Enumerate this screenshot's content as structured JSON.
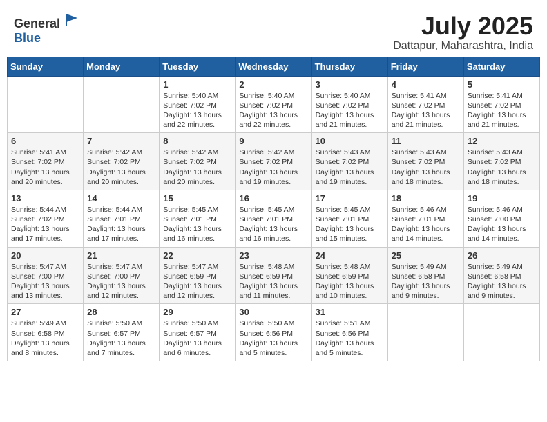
{
  "logo": {
    "general": "General",
    "blue": "Blue"
  },
  "title": "July 2025",
  "location": "Dattapur, Maharashtra, India",
  "days_of_week": [
    "Sunday",
    "Monday",
    "Tuesday",
    "Wednesday",
    "Thursday",
    "Friday",
    "Saturday"
  ],
  "weeks": [
    [
      {
        "day": "",
        "sunrise": "",
        "sunset": "",
        "daylight": ""
      },
      {
        "day": "",
        "sunrise": "",
        "sunset": "",
        "daylight": ""
      },
      {
        "day": "1",
        "sunrise": "Sunrise: 5:40 AM",
        "sunset": "Sunset: 7:02 PM",
        "daylight": "Daylight: 13 hours and 22 minutes."
      },
      {
        "day": "2",
        "sunrise": "Sunrise: 5:40 AM",
        "sunset": "Sunset: 7:02 PM",
        "daylight": "Daylight: 13 hours and 22 minutes."
      },
      {
        "day": "3",
        "sunrise": "Sunrise: 5:40 AM",
        "sunset": "Sunset: 7:02 PM",
        "daylight": "Daylight: 13 hours and 21 minutes."
      },
      {
        "day": "4",
        "sunrise": "Sunrise: 5:41 AM",
        "sunset": "Sunset: 7:02 PM",
        "daylight": "Daylight: 13 hours and 21 minutes."
      },
      {
        "day": "5",
        "sunrise": "Sunrise: 5:41 AM",
        "sunset": "Sunset: 7:02 PM",
        "daylight": "Daylight: 13 hours and 21 minutes."
      }
    ],
    [
      {
        "day": "6",
        "sunrise": "Sunrise: 5:41 AM",
        "sunset": "Sunset: 7:02 PM",
        "daylight": "Daylight: 13 hours and 20 minutes."
      },
      {
        "day": "7",
        "sunrise": "Sunrise: 5:42 AM",
        "sunset": "Sunset: 7:02 PM",
        "daylight": "Daylight: 13 hours and 20 minutes."
      },
      {
        "day": "8",
        "sunrise": "Sunrise: 5:42 AM",
        "sunset": "Sunset: 7:02 PM",
        "daylight": "Daylight: 13 hours and 20 minutes."
      },
      {
        "day": "9",
        "sunrise": "Sunrise: 5:42 AM",
        "sunset": "Sunset: 7:02 PM",
        "daylight": "Daylight: 13 hours and 19 minutes."
      },
      {
        "day": "10",
        "sunrise": "Sunrise: 5:43 AM",
        "sunset": "Sunset: 7:02 PM",
        "daylight": "Daylight: 13 hours and 19 minutes."
      },
      {
        "day": "11",
        "sunrise": "Sunrise: 5:43 AM",
        "sunset": "Sunset: 7:02 PM",
        "daylight": "Daylight: 13 hours and 18 minutes."
      },
      {
        "day": "12",
        "sunrise": "Sunrise: 5:43 AM",
        "sunset": "Sunset: 7:02 PM",
        "daylight": "Daylight: 13 hours and 18 minutes."
      }
    ],
    [
      {
        "day": "13",
        "sunrise": "Sunrise: 5:44 AM",
        "sunset": "Sunset: 7:02 PM",
        "daylight": "Daylight: 13 hours and 17 minutes."
      },
      {
        "day": "14",
        "sunrise": "Sunrise: 5:44 AM",
        "sunset": "Sunset: 7:01 PM",
        "daylight": "Daylight: 13 hours and 17 minutes."
      },
      {
        "day": "15",
        "sunrise": "Sunrise: 5:45 AM",
        "sunset": "Sunset: 7:01 PM",
        "daylight": "Daylight: 13 hours and 16 minutes."
      },
      {
        "day": "16",
        "sunrise": "Sunrise: 5:45 AM",
        "sunset": "Sunset: 7:01 PM",
        "daylight": "Daylight: 13 hours and 16 minutes."
      },
      {
        "day": "17",
        "sunrise": "Sunrise: 5:45 AM",
        "sunset": "Sunset: 7:01 PM",
        "daylight": "Daylight: 13 hours and 15 minutes."
      },
      {
        "day": "18",
        "sunrise": "Sunrise: 5:46 AM",
        "sunset": "Sunset: 7:01 PM",
        "daylight": "Daylight: 13 hours and 14 minutes."
      },
      {
        "day": "19",
        "sunrise": "Sunrise: 5:46 AM",
        "sunset": "Sunset: 7:00 PM",
        "daylight": "Daylight: 13 hours and 14 minutes."
      }
    ],
    [
      {
        "day": "20",
        "sunrise": "Sunrise: 5:47 AM",
        "sunset": "Sunset: 7:00 PM",
        "daylight": "Daylight: 13 hours and 13 minutes."
      },
      {
        "day": "21",
        "sunrise": "Sunrise: 5:47 AM",
        "sunset": "Sunset: 7:00 PM",
        "daylight": "Daylight: 13 hours and 12 minutes."
      },
      {
        "day": "22",
        "sunrise": "Sunrise: 5:47 AM",
        "sunset": "Sunset: 6:59 PM",
        "daylight": "Daylight: 13 hours and 12 minutes."
      },
      {
        "day": "23",
        "sunrise": "Sunrise: 5:48 AM",
        "sunset": "Sunset: 6:59 PM",
        "daylight": "Daylight: 13 hours and 11 minutes."
      },
      {
        "day": "24",
        "sunrise": "Sunrise: 5:48 AM",
        "sunset": "Sunset: 6:59 PM",
        "daylight": "Daylight: 13 hours and 10 minutes."
      },
      {
        "day": "25",
        "sunrise": "Sunrise: 5:49 AM",
        "sunset": "Sunset: 6:58 PM",
        "daylight": "Daylight: 13 hours and 9 minutes."
      },
      {
        "day": "26",
        "sunrise": "Sunrise: 5:49 AM",
        "sunset": "Sunset: 6:58 PM",
        "daylight": "Daylight: 13 hours and 9 minutes."
      }
    ],
    [
      {
        "day": "27",
        "sunrise": "Sunrise: 5:49 AM",
        "sunset": "Sunset: 6:58 PM",
        "daylight": "Daylight: 13 hours and 8 minutes."
      },
      {
        "day": "28",
        "sunrise": "Sunrise: 5:50 AM",
        "sunset": "Sunset: 6:57 PM",
        "daylight": "Daylight: 13 hours and 7 minutes."
      },
      {
        "day": "29",
        "sunrise": "Sunrise: 5:50 AM",
        "sunset": "Sunset: 6:57 PM",
        "daylight": "Daylight: 13 hours and 6 minutes."
      },
      {
        "day": "30",
        "sunrise": "Sunrise: 5:50 AM",
        "sunset": "Sunset: 6:56 PM",
        "daylight": "Daylight: 13 hours and 5 minutes."
      },
      {
        "day": "31",
        "sunrise": "Sunrise: 5:51 AM",
        "sunset": "Sunset: 6:56 PM",
        "daylight": "Daylight: 13 hours and 5 minutes."
      },
      {
        "day": "",
        "sunrise": "",
        "sunset": "",
        "daylight": ""
      },
      {
        "day": "",
        "sunrise": "",
        "sunset": "",
        "daylight": ""
      }
    ]
  ]
}
